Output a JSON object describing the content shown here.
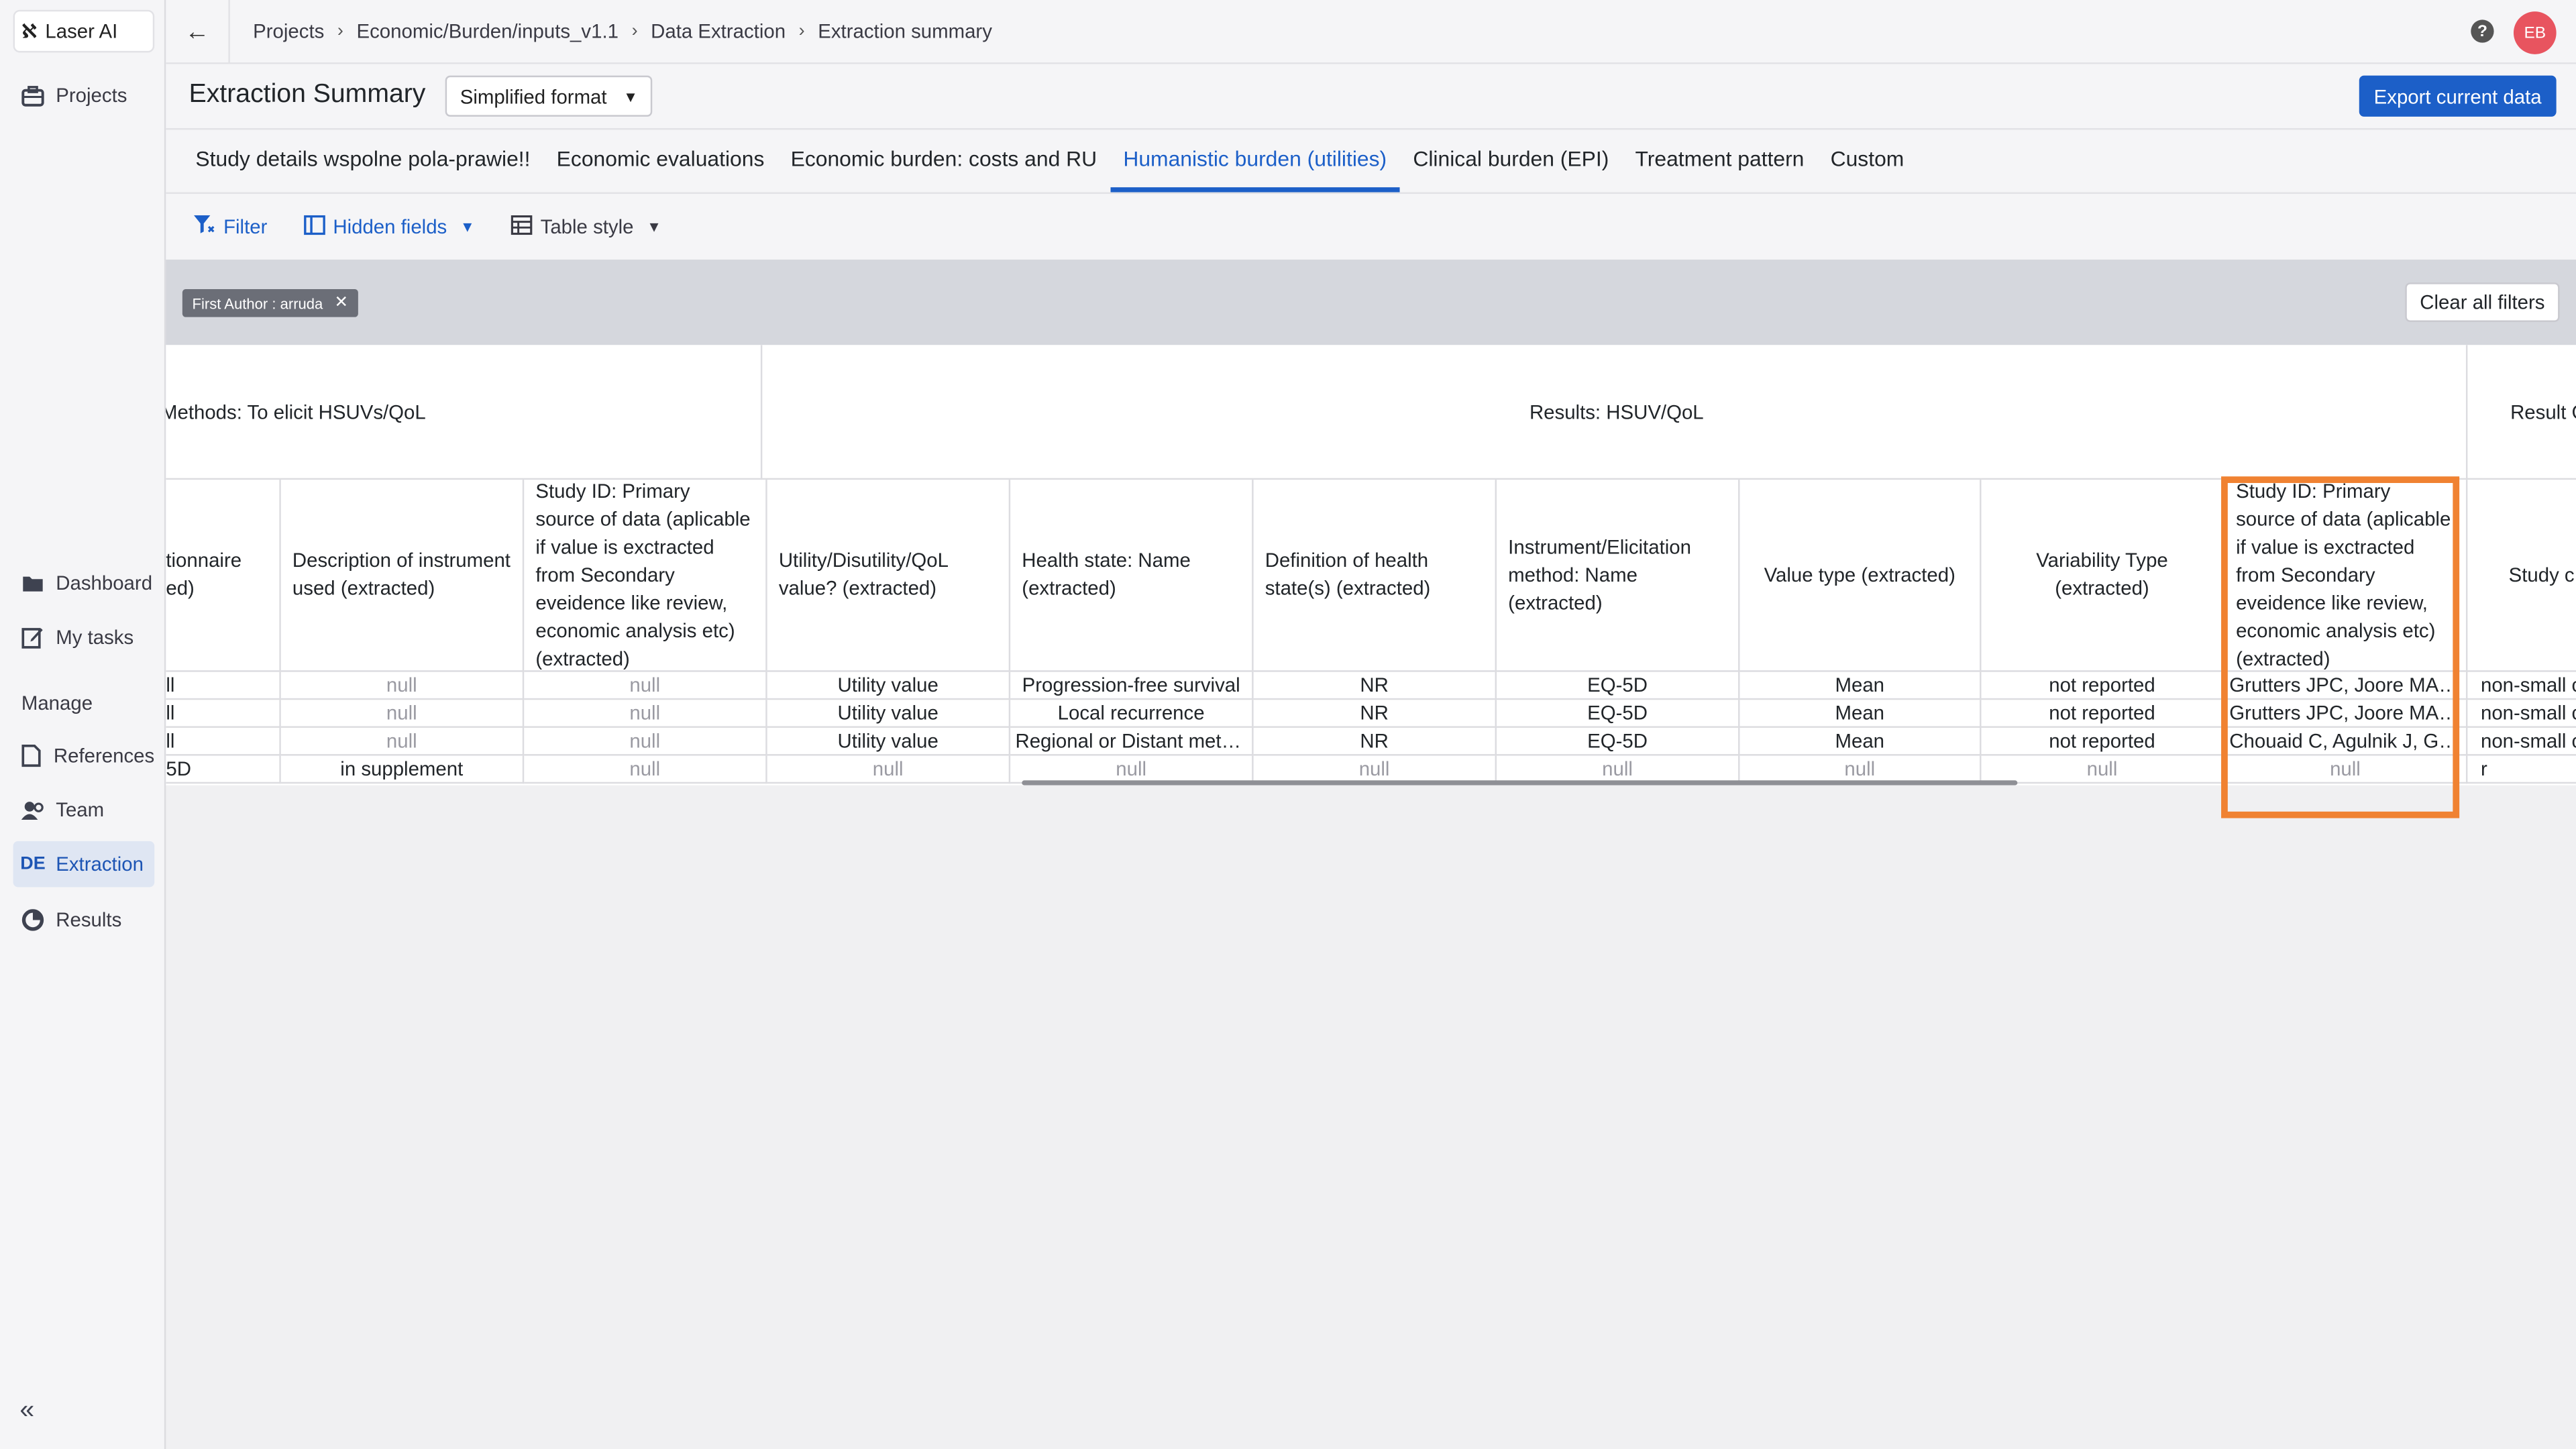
{
  "app": {
    "name": "Laser AI",
    "logo_mark": "ℵ"
  },
  "sidebar": {
    "top_items": [
      {
        "label": "Projects",
        "icon": "briefcase-icon"
      }
    ],
    "items": [
      {
        "label": "Dashboard",
        "icon": "folder-icon"
      },
      {
        "label": "My tasks",
        "icon": "edit-icon"
      }
    ],
    "manage_heading": "Manage",
    "manage_items": [
      {
        "label": "References",
        "icon": "document-icon"
      },
      {
        "label": "Team",
        "icon": "users-icon"
      },
      {
        "label": "Extraction",
        "icon": "DE",
        "active": true
      },
      {
        "label": "Results",
        "icon": "pie-chart-icon"
      }
    ],
    "collapse_glyph": "«"
  },
  "topbar": {
    "back_glyph": "←",
    "breadcrumbs": [
      "Projects",
      "Economic/Burden/inputs_v1.1",
      "Data Extraction",
      "Extraction summary"
    ],
    "separator": "›",
    "help_glyph": "?",
    "avatar_initials": "EB"
  },
  "header": {
    "title": "Extraction Summary",
    "format_select": "Simplified format",
    "export_label": "Export current data"
  },
  "tabs": [
    {
      "label": "Study details wspolne pola-prawie!!"
    },
    {
      "label": "Economic evaluations"
    },
    {
      "label": "Economic burden: costs and RU"
    },
    {
      "label": "Humanistic burden (utilities)",
      "active": true
    },
    {
      "label": "Clinical burden (EPI)"
    },
    {
      "label": "Treatment pattern"
    },
    {
      "label": "Custom"
    }
  ],
  "toolbar": {
    "filter_label": "Filter",
    "hidden_fields_label": "Hidden fields",
    "table_style_label": "Table style"
  },
  "filters": {
    "chip_label": "First Author : arruda",
    "clear_label": "Clear all filters"
  },
  "table": {
    "groups": [
      {
        "label": "Methods: To elicit HSUVs/QoL"
      },
      {
        "label": "Results: HSUV/QoL"
      },
      {
        "label": "Result G"
      }
    ],
    "columns": [
      "tionnaire ed)",
      "Description of instrument used (extracted)",
      "Study ID: Primary source of data (aplicable if value is exctracted from Secondary eveidence like review, economic analysis etc) (extracted)",
      "Utility/Disutility/QoL value? (extracted)",
      "Health state: Name (extracted)",
      "Definition of health state(s) (extracted)",
      "Instrument/Elicitation method: Name (extracted)",
      "Value type (extracted)",
      "Variability Type (extracted)",
      "Study ID: Primary source of data (aplicable if value is exctracted from Secondary eveidence like review, economic analysis etc) (extracted)",
      "Study c"
    ],
    "rows": [
      [
        "ll",
        "null",
        "null",
        "Utility value",
        "Progression-free survival",
        "NR",
        "EQ-5D",
        "Mean",
        "not reported",
        "Grutters JPC, Joore MA, W...",
        "non-small c"
      ],
      [
        "ll",
        "null",
        "null",
        "Utility value",
        "Local recurrence",
        "NR",
        "EQ-5D",
        "Mean",
        "not reported",
        "Grutters JPC, Joore MA, W...",
        "non-small c"
      ],
      [
        "ll",
        "null",
        "null",
        "Utility value",
        "Regional or Distant metas...",
        "NR",
        "EQ-5D",
        "Mean",
        "not reported",
        "Chouaid C, Agulnik J, Gok...",
        "non-small c"
      ],
      [
        "5D",
        "in supplement",
        "null",
        "null",
        "null",
        "null",
        "null",
        "null",
        "null",
        "null",
        "r"
      ]
    ]
  },
  "colors": {
    "accent": "#1c5fc8",
    "highlight": "#f08232",
    "avatar": "#e8545f"
  }
}
